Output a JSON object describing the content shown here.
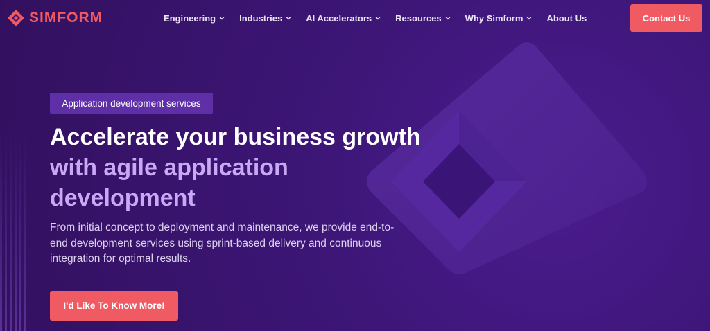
{
  "brand": {
    "name": "SIMFORM",
    "color": "#f05a63"
  },
  "nav": {
    "items": [
      {
        "label": "Engineering",
        "has_dropdown": true
      },
      {
        "label": "Industries",
        "has_dropdown": true
      },
      {
        "label": "AI Accelerators",
        "has_dropdown": true
      },
      {
        "label": "Resources",
        "has_dropdown": true
      },
      {
        "label": "Why Simform",
        "has_dropdown": true
      },
      {
        "label": "About Us",
        "has_dropdown": false
      }
    ],
    "contact_label": "Contact Us"
  },
  "hero": {
    "tag": "Application development services",
    "headline_white": "Accelerate your business growth",
    "headline_accent": "with agile application development",
    "description": "From initial concept to deployment and maintenance, we provide end-to-end development services using sprint-based delivery and continuous integration for optimal results.",
    "cta_label": "I'd Like To Know More!"
  },
  "colors": {
    "background": "#3b1475",
    "accent_text": "#c8a9f5",
    "button": "#f05a63",
    "tag_bg": "#5e2fa6"
  }
}
